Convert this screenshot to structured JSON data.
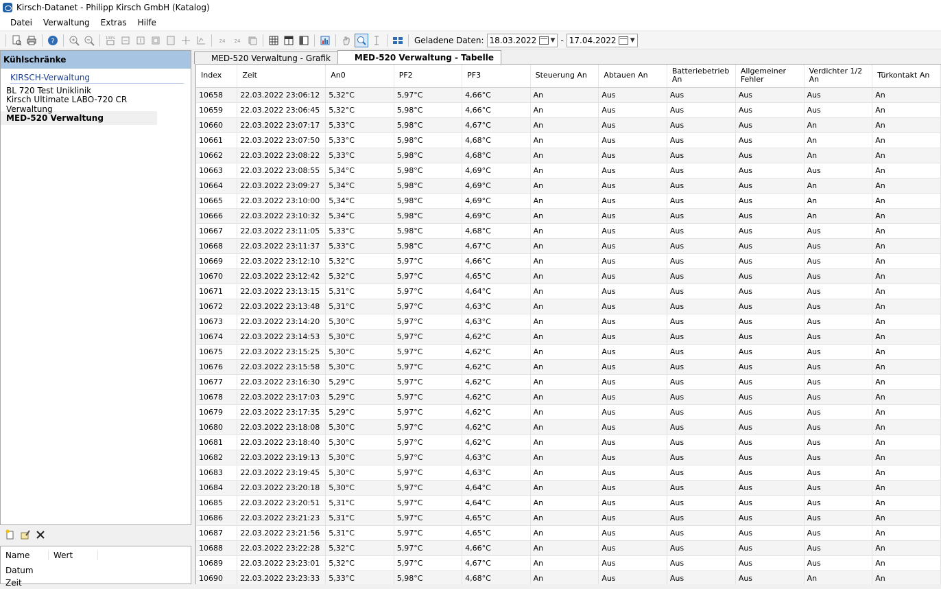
{
  "window": {
    "title": "Kirsch-Datanet - Philipp Kirsch GmbH (Katalog)"
  },
  "menu": [
    "Datei",
    "Verwaltung",
    "Extras",
    "Hilfe"
  ],
  "toolbar": {
    "loaded_label": "Geladene Daten:",
    "date_from": "18.03.2022",
    "date_separator": "-",
    "date_to": "17.04.2022"
  },
  "sidebar": {
    "header": "Kühlschränke",
    "group": "KIRSCH-Verwaltung",
    "items": [
      "BL 720 Test Uniklinik",
      "Kirsch Ultimate LABO-720 CR Verwaltung",
      "MED-520 Verwaltung"
    ],
    "selected_index": 2
  },
  "properties": {
    "columns": [
      "Name",
      "Wert"
    ],
    "rows": [
      "Datum",
      "Zeit"
    ]
  },
  "tabs": [
    {
      "label": "MED-520 Verwaltung - Grafik",
      "active": false
    },
    {
      "label": "MED-520 Verwaltung - Tabelle",
      "active": true
    }
  ],
  "table": {
    "columns": [
      "Index",
      "Zeit",
      "An0",
      "PF2",
      "PF3",
      "Steuerung An",
      "Abtauen An",
      "Batteriebetrieb An",
      "Allgemeiner Fehler",
      "Verdichter 1/2 An",
      "Türkontakt An"
    ],
    "rows": [
      [
        "10658",
        "22.03.2022 23:06:12",
        "5,32°C",
        "5,97°C",
        "4,66°C",
        "An",
        "Aus",
        "Aus",
        "Aus",
        "Aus",
        "An"
      ],
      [
        "10659",
        "22.03.2022 23:06:45",
        "5,32°C",
        "5,98°C",
        "4,66°C",
        "An",
        "Aus",
        "Aus",
        "Aus",
        "Aus",
        "An"
      ],
      [
        "10660",
        "22.03.2022 23:07:17",
        "5,33°C",
        "5,98°C",
        "4,67°C",
        "An",
        "Aus",
        "Aus",
        "Aus",
        "An",
        "An"
      ],
      [
        "10661",
        "22.03.2022 23:07:50",
        "5,33°C",
        "5,98°C",
        "4,68°C",
        "An",
        "Aus",
        "Aus",
        "Aus",
        "An",
        "An"
      ],
      [
        "10662",
        "22.03.2022 23:08:22",
        "5,33°C",
        "5,98°C",
        "4,68°C",
        "An",
        "Aus",
        "Aus",
        "Aus",
        "An",
        "An"
      ],
      [
        "10663",
        "22.03.2022 23:08:55",
        "5,34°C",
        "5,98°C",
        "4,69°C",
        "An",
        "Aus",
        "Aus",
        "Aus",
        "Aus",
        "An"
      ],
      [
        "10664",
        "22.03.2022 23:09:27",
        "5,34°C",
        "5,98°C",
        "4,69°C",
        "An",
        "Aus",
        "Aus",
        "Aus",
        "An",
        "An"
      ],
      [
        "10665",
        "22.03.2022 23:10:00",
        "5,34°C",
        "5,98°C",
        "4,69°C",
        "An",
        "Aus",
        "Aus",
        "Aus",
        "An",
        "An"
      ],
      [
        "10666",
        "22.03.2022 23:10:32",
        "5,34°C",
        "5,98°C",
        "4,69°C",
        "An",
        "Aus",
        "Aus",
        "Aus",
        "An",
        "An"
      ],
      [
        "10667",
        "22.03.2022 23:11:05",
        "5,33°C",
        "5,98°C",
        "4,68°C",
        "An",
        "Aus",
        "Aus",
        "Aus",
        "Aus",
        "An"
      ],
      [
        "10668",
        "22.03.2022 23:11:37",
        "5,33°C",
        "5,98°C",
        "4,67°C",
        "An",
        "Aus",
        "Aus",
        "Aus",
        "Aus",
        "An"
      ],
      [
        "10669",
        "22.03.2022 23:12:10",
        "5,32°C",
        "5,97°C",
        "4,66°C",
        "An",
        "Aus",
        "Aus",
        "Aus",
        "Aus",
        "An"
      ],
      [
        "10670",
        "22.03.2022 23:12:42",
        "5,32°C",
        "5,97°C",
        "4,65°C",
        "An",
        "Aus",
        "Aus",
        "Aus",
        "Aus",
        "An"
      ],
      [
        "10671",
        "22.03.2022 23:13:15",
        "5,31°C",
        "5,97°C",
        "4,64°C",
        "An",
        "Aus",
        "Aus",
        "Aus",
        "Aus",
        "An"
      ],
      [
        "10672",
        "22.03.2022 23:13:48",
        "5,31°C",
        "5,97°C",
        "4,63°C",
        "An",
        "Aus",
        "Aus",
        "Aus",
        "Aus",
        "An"
      ],
      [
        "10673",
        "22.03.2022 23:14:20",
        "5,30°C",
        "5,97°C",
        "4,63°C",
        "An",
        "Aus",
        "Aus",
        "Aus",
        "Aus",
        "An"
      ],
      [
        "10674",
        "22.03.2022 23:14:53",
        "5,30°C",
        "5,97°C",
        "4,62°C",
        "An",
        "Aus",
        "Aus",
        "Aus",
        "Aus",
        "An"
      ],
      [
        "10675",
        "22.03.2022 23:15:25",
        "5,30°C",
        "5,97°C",
        "4,62°C",
        "An",
        "Aus",
        "Aus",
        "Aus",
        "Aus",
        "An"
      ],
      [
        "10676",
        "22.03.2022 23:15:58",
        "5,30°C",
        "5,97°C",
        "4,62°C",
        "An",
        "Aus",
        "Aus",
        "Aus",
        "Aus",
        "An"
      ],
      [
        "10677",
        "22.03.2022 23:16:30",
        "5,29°C",
        "5,97°C",
        "4,62°C",
        "An",
        "Aus",
        "Aus",
        "Aus",
        "Aus",
        "An"
      ],
      [
        "10678",
        "22.03.2022 23:17:03",
        "5,29°C",
        "5,97°C",
        "4,62°C",
        "An",
        "Aus",
        "Aus",
        "Aus",
        "Aus",
        "An"
      ],
      [
        "10679",
        "22.03.2022 23:17:35",
        "5,29°C",
        "5,97°C",
        "4,62°C",
        "An",
        "Aus",
        "Aus",
        "Aus",
        "Aus",
        "An"
      ],
      [
        "10680",
        "22.03.2022 23:18:08",
        "5,30°C",
        "5,97°C",
        "4,62°C",
        "An",
        "Aus",
        "Aus",
        "Aus",
        "Aus",
        "An"
      ],
      [
        "10681",
        "22.03.2022 23:18:40",
        "5,30°C",
        "5,97°C",
        "4,62°C",
        "An",
        "Aus",
        "Aus",
        "Aus",
        "Aus",
        "An"
      ],
      [
        "10682",
        "22.03.2022 23:19:13",
        "5,30°C",
        "5,97°C",
        "4,63°C",
        "An",
        "Aus",
        "Aus",
        "Aus",
        "Aus",
        "An"
      ],
      [
        "10683",
        "22.03.2022 23:19:45",
        "5,30°C",
        "5,97°C",
        "4,63°C",
        "An",
        "Aus",
        "Aus",
        "Aus",
        "Aus",
        "An"
      ],
      [
        "10684",
        "22.03.2022 23:20:18",
        "5,30°C",
        "5,97°C",
        "4,64°C",
        "An",
        "Aus",
        "Aus",
        "Aus",
        "Aus",
        "An"
      ],
      [
        "10685",
        "22.03.2022 23:20:51",
        "5,31°C",
        "5,97°C",
        "4,64°C",
        "An",
        "Aus",
        "Aus",
        "Aus",
        "Aus",
        "An"
      ],
      [
        "10686",
        "22.03.2022 23:21:23",
        "5,31°C",
        "5,97°C",
        "4,65°C",
        "An",
        "Aus",
        "Aus",
        "Aus",
        "Aus",
        "An"
      ],
      [
        "10687",
        "22.03.2022 23:21:56",
        "5,31°C",
        "5,97°C",
        "4,65°C",
        "An",
        "Aus",
        "Aus",
        "Aus",
        "Aus",
        "An"
      ],
      [
        "10688",
        "22.03.2022 23:22:28",
        "5,32°C",
        "5,97°C",
        "4,66°C",
        "An",
        "Aus",
        "Aus",
        "Aus",
        "Aus",
        "An"
      ],
      [
        "10689",
        "22.03.2022 23:23:01",
        "5,32°C",
        "5,97°C",
        "4,67°C",
        "An",
        "Aus",
        "Aus",
        "Aus",
        "Aus",
        "An"
      ],
      [
        "10690",
        "22.03.2022 23:23:33",
        "5,33°C",
        "5,98°C",
        "4,68°C",
        "An",
        "Aus",
        "Aus",
        "Aus",
        "An",
        "An"
      ]
    ]
  },
  "colors": {
    "sidebar_header": "#a7c4e3",
    "group_text": "#1e3f8e",
    "toolbar_accent": "#2d6bb5"
  },
  "icons": {
    "toolbar": [
      "print-preview-icon",
      "print-icon",
      "help-icon",
      "zoom-in-icon",
      "zoom-out-icon",
      "zoom-100-icon",
      "bar-chart-icon",
      "table-icon",
      "hand-pan-icon",
      "zoom-select-icon",
      "cursor-icon",
      "layout-icon"
    ],
    "bottom": [
      "new-icon",
      "edit-icon",
      "delete-icon"
    ]
  }
}
